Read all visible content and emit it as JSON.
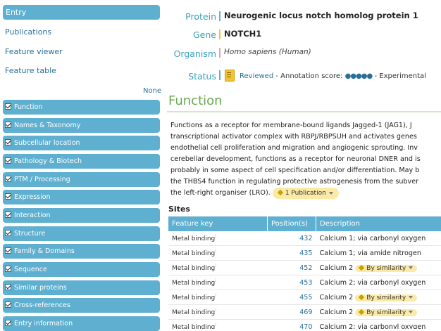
{
  "sidebar": {
    "entry_label": "Entry",
    "links": [
      "Publications",
      "Feature viewer",
      "Feature table"
    ],
    "none_label": "None",
    "sections": [
      "Function",
      "Names & Taxonomy",
      "Subcellular location",
      "Pathology & Biotech",
      "PTM / Processing",
      "Expression",
      "Interaction",
      "Structure",
      "Family & Domains",
      "Sequence",
      "Similar proteins",
      "Cross-references",
      "Entry information"
    ]
  },
  "header": {
    "protein_label": "Protein",
    "protein_value": "Neurogenic locus notch homolog protein 1",
    "gene_label": "Gene",
    "gene_value": "NOTCH1",
    "organism_label": "Organism",
    "organism_value": "Homo sapiens (Human)",
    "status_label": "Status",
    "status_reviewed": "Reviewed",
    "status_dash1": "-",
    "annotation_label": "Annotation score:",
    "annotation_dots": "●●●●●",
    "status_dash2": "-",
    "status_experimental": "Experimental",
    "bar_colors": [
      "#5fb0d0",
      "#f1c232",
      "#e8a0a0",
      "#5fb0d0"
    ]
  },
  "function": {
    "title": "Function",
    "sup": "i",
    "lines": [
      "Functions as a receptor for membrane-bound ligands Jagged-1 (JAG1), J",
      "transcriptional activator complex with RBPJ/RBPSUH and activates genes",
      "endothelial cell proliferation and migration and angiogenic sprouting. Inv",
      "cerebellar development, functions as a receptor for neuronal DNER and is",
      "probably in some aspect of cell specification and/or differentiation. May b",
      "the THBS4 function in regulating protective astrogenesis from the subver",
      "the left-right organiser (LRO)."
    ],
    "pub_badge": "1 Publication"
  },
  "sites": {
    "title": "Sites",
    "columns": [
      "Feature key",
      "Position(s)",
      "Description"
    ],
    "rows": [
      {
        "key": "Metal binding",
        "pos": "432",
        "desc": "Calcium 1; via carbonyl oxygen",
        "badge": ""
      },
      {
        "key": "Metal binding",
        "pos": "435",
        "desc": "Calcium 1; via amide nitrogen",
        "badge": ""
      },
      {
        "key": "Metal binding",
        "pos": "452",
        "desc": "Calcium 2",
        "badge": "By similarity"
      },
      {
        "key": "Metal binding",
        "pos": "453",
        "desc": "Calcium 2; via carbonyl oxygen",
        "badge": ""
      },
      {
        "key": "Metal binding",
        "pos": "455",
        "desc": "Calcium 2",
        "badge": "By similarity"
      },
      {
        "key": "Metal binding",
        "pos": "469",
        "desc": "Calcium 2",
        "badge": "By similarity"
      },
      {
        "key": "Metal binding",
        "pos": "470",
        "desc": "Calcium 2; via carbonyl oxygen",
        "badge": ""
      }
    ]
  }
}
